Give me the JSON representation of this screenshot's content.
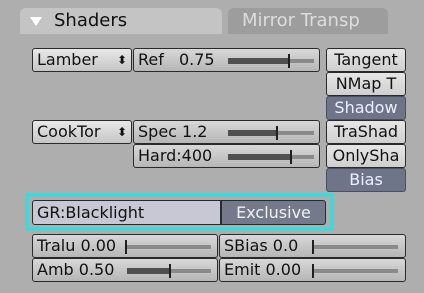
{
  "tabs": {
    "active": "Shaders",
    "inactive": "Mirror Transp"
  },
  "diffuse": {
    "shader_label": "Lamber",
    "ref_label": "Ref",
    "ref_value": "0.75"
  },
  "specular": {
    "shader_label": "CookTor",
    "spec_label": "Spec 1.2",
    "hard_label": "Hard:400"
  },
  "toggles": {
    "tangent": "Tangent",
    "nmap": "NMap T",
    "shadow": "Shadow",
    "trashad": "TraShad",
    "onlysha": "OnlySha",
    "bias": "Bias"
  },
  "group": {
    "field_value": "GR:Blacklight",
    "exclusive_label": "Exclusive"
  },
  "bottom": {
    "tralu": "Tralu 0.00",
    "sbias": "SBias 0.0",
    "amb": "Amb 0.50",
    "emit": "Emit 0.00"
  },
  "slider_levels": {
    "ref": 0.75,
    "spec": 0.6,
    "hard": 0.78,
    "tralu": 0.0,
    "sbias": 0.0,
    "amb": 0.5,
    "emit": 0.0
  },
  "colors": {
    "highlight": "#47d6d8",
    "active_toggle": "#6f7588"
  }
}
